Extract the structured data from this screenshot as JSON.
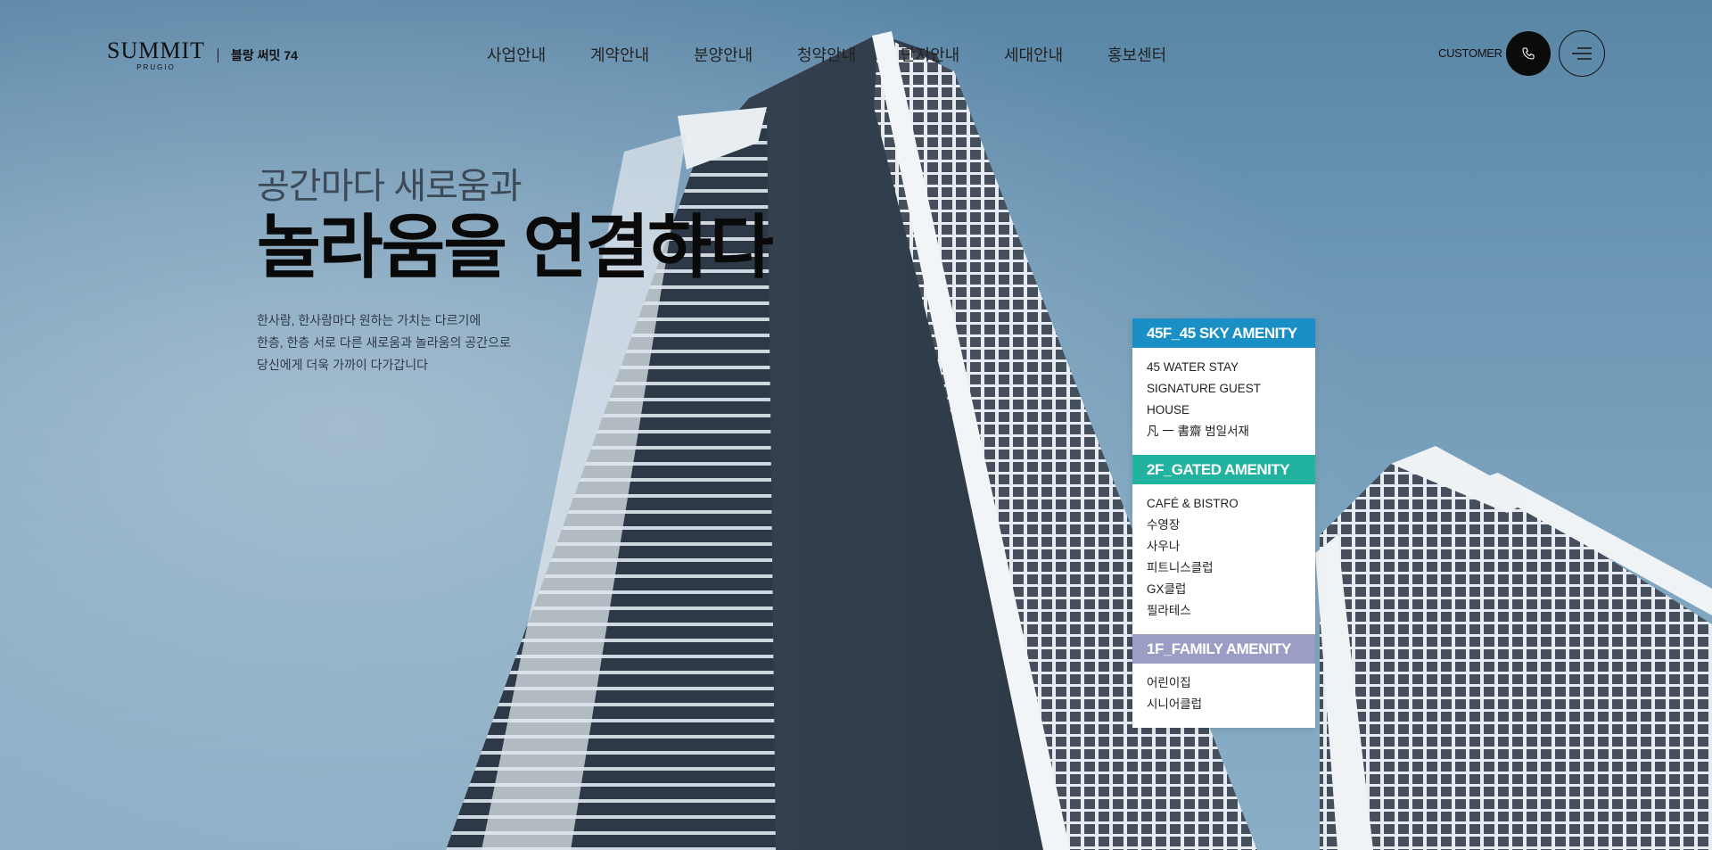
{
  "brand": {
    "logo_word": "SUMMIT",
    "logo_sub": "PRUGIO",
    "site_name": "블랑 써밋 74"
  },
  "nav": {
    "items": [
      "사업안내",
      "계약안내",
      "분양안내",
      "청약안내",
      "단지안내",
      "세대안내",
      "홍보센터"
    ]
  },
  "header": {
    "customer_label": "CUSTOMER",
    "call_icon": "phone-icon",
    "menu_icon": "hamburger-menu-icon"
  },
  "hero": {
    "subtitle": "공간마다 새로움과",
    "title": "놀라움을 연결하다",
    "description": [
      "한사람, 한사람마다 원하는 가치는 다르기에",
      "한층, 한층 서로 다른 새로움과 놀라움의 공간으로",
      "당신에게 더욱 가까이 다가갑니다"
    ]
  },
  "amenities": [
    {
      "title": "45F_45 SKY AMENITY",
      "color": "#1a8fc6",
      "items": [
        "45 WATER STAY",
        "SIGNATURE GUEST HOUSE",
        "凡 一 書齋 범일서재"
      ]
    },
    {
      "title": "2F_GATED AMENITY",
      "color": "#22b3a0",
      "items": [
        "CAFÉ & BISTRO",
        "수영장",
        "사우나",
        "피트니스클럽",
        "GX클럽",
        "필라테스"
      ]
    },
    {
      "title": "1F_FAMILY AMENITY",
      "color": "#9a9ec4",
      "items": [
        "어린이집",
        "시니어클럽"
      ]
    }
  ]
}
